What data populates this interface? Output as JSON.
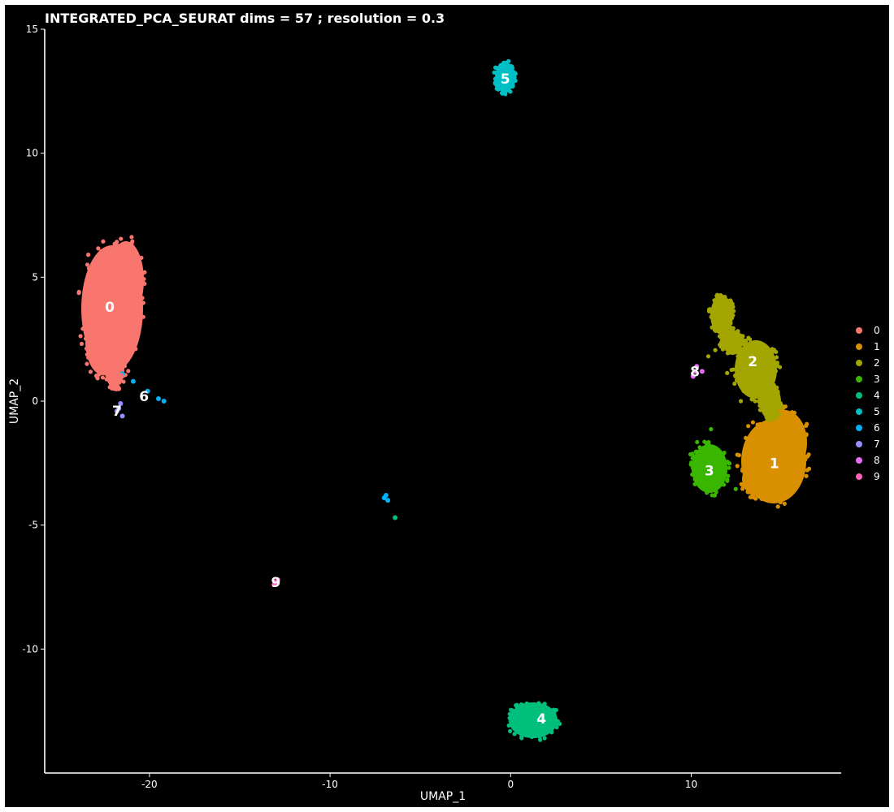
{
  "chart_data": {
    "type": "scatter",
    "title": "INTEGRATED_PCA_SEURAT dims =  57 ; resolution = 0.3",
    "xlabel": "UMAP_1",
    "ylabel": "UMAP_2",
    "xlim": [
      -25.8,
      18.3
    ],
    "ylim": [
      -15,
      15
    ],
    "x_ticks": [
      -20,
      -10,
      0,
      10
    ],
    "y_ticks": [
      -10,
      -5,
      0,
      5,
      10,
      15
    ],
    "x_tick_labels": [
      "-20",
      "-10",
      "0",
      "10"
    ],
    "y_tick_labels": [
      "-10",
      "-5",
      "0",
      "5",
      "10",
      "15"
    ],
    "grid": false,
    "background": "#000000",
    "legend_position": "right",
    "colors": {
      "0": "#F8766D",
      "1": "#D89000",
      "2": "#A3A500",
      "3": "#39B600",
      "4": "#00BF7D",
      "5": "#00BFC4",
      "6": "#00B0F6",
      "7": "#9590FF",
      "8": "#E76BF3",
      "9": "#FF62BC"
    },
    "legend": [
      "0",
      "1",
      "2",
      "3",
      "4",
      "5",
      "6",
      "7",
      "8",
      "9"
    ],
    "clusters": [
      {
        "name": "0",
        "label_x": -22.2,
        "label_y": 3.8,
        "points": [
          [
            -22.3,
            3.8
          ],
          [
            -22.0,
            5.0
          ],
          [
            -21.5,
            4.4
          ],
          [
            -22.7,
            3.0
          ],
          [
            -21.6,
            2.0
          ],
          [
            -22.0,
            1.3
          ],
          [
            -21.2,
            5.6
          ],
          [
            -20.6,
            4.2
          ],
          [
            -23.3,
            3.5
          ],
          [
            -21.9,
            6.3
          ],
          [
            -21.7,
            0.5
          ]
        ]
      },
      {
        "name": "1",
        "label_x": 14.6,
        "label_y": -2.5,
        "points": [
          [
            14.6,
            -2.5
          ],
          [
            14.0,
            -3.3
          ],
          [
            15.4,
            -1.8
          ],
          [
            13.3,
            -2.8
          ],
          [
            15.5,
            -3.0
          ],
          [
            14.2,
            -1.0
          ],
          [
            15.0,
            -3.7
          ],
          [
            13.0,
            -2.0
          ],
          [
            15.9,
            -2.4
          ]
        ]
      },
      {
        "name": "2",
        "label_x": 13.4,
        "label_y": 1.6,
        "points": [
          [
            13.4,
            1.6
          ],
          [
            14.2,
            1.0
          ],
          [
            11.6,
            3.8
          ],
          [
            12.0,
            2.6
          ],
          [
            14.6,
            -0.2
          ],
          [
            13.0,
            2.4
          ],
          [
            11.4,
            3.0
          ],
          [
            14.0,
            0.5
          ],
          [
            12.6,
            1.8
          ]
        ]
      },
      {
        "name": "3",
        "label_x": 11.0,
        "label_y": -2.8,
        "points": [
          [
            11.0,
            -2.8
          ],
          [
            10.6,
            -2.2
          ],
          [
            11.4,
            -3.3
          ],
          [
            10.4,
            -3.0
          ],
          [
            11.6,
            -2.4
          ],
          [
            11.0,
            -1.8
          ]
        ]
      },
      {
        "name": "4",
        "label_x": 1.7,
        "label_y": -12.8,
        "points": [
          [
            1.7,
            -12.8
          ],
          [
            0.8,
            -12.6
          ],
          [
            2.2,
            -13.1
          ],
          [
            1.2,
            -12.3
          ],
          [
            0.6,
            -13.0
          ],
          [
            2.0,
            -12.4
          ],
          [
            -6.4,
            -4.7
          ]
        ]
      },
      {
        "name": "5",
        "label_x": -0.3,
        "label_y": 13.0,
        "points": [
          [
            -0.3,
            13.0
          ],
          [
            0.0,
            13.5
          ],
          [
            -0.5,
            12.8
          ],
          [
            0.1,
            12.7
          ],
          [
            -0.2,
            13.3
          ]
        ]
      },
      {
        "name": "6",
        "label_x": -20.3,
        "label_y": 0.2,
        "points": [
          [
            -21.5,
            1.1
          ],
          [
            -20.9,
            0.8
          ],
          [
            -20.1,
            0.4
          ],
          [
            -19.5,
            0.1
          ],
          [
            -19.2,
            0.0
          ],
          [
            -6.9,
            -3.8
          ],
          [
            -7.0,
            -3.9
          ],
          [
            -6.8,
            -4.0
          ]
        ]
      },
      {
        "name": "7",
        "label_x": -21.8,
        "label_y": -0.4,
        "points": [
          [
            -21.8,
            -0.4
          ],
          [
            -21.6,
            -0.1
          ],
          [
            -21.5,
            -0.6
          ],
          [
            -21.7,
            -0.3
          ]
        ]
      },
      {
        "name": "8",
        "label_x": 10.2,
        "label_y": 1.2,
        "points": [
          [
            10.2,
            1.2
          ],
          [
            10.3,
            1.4
          ],
          [
            10.6,
            1.2
          ],
          [
            10.1,
            1.0
          ]
        ]
      },
      {
        "name": "9",
        "label_x": -13.0,
        "label_y": -7.3,
        "points": [
          [
            -13.0,
            -7.3
          ],
          [
            -12.9,
            -7.2
          ],
          [
            -13.1,
            -7.4
          ]
        ]
      }
    ]
  }
}
